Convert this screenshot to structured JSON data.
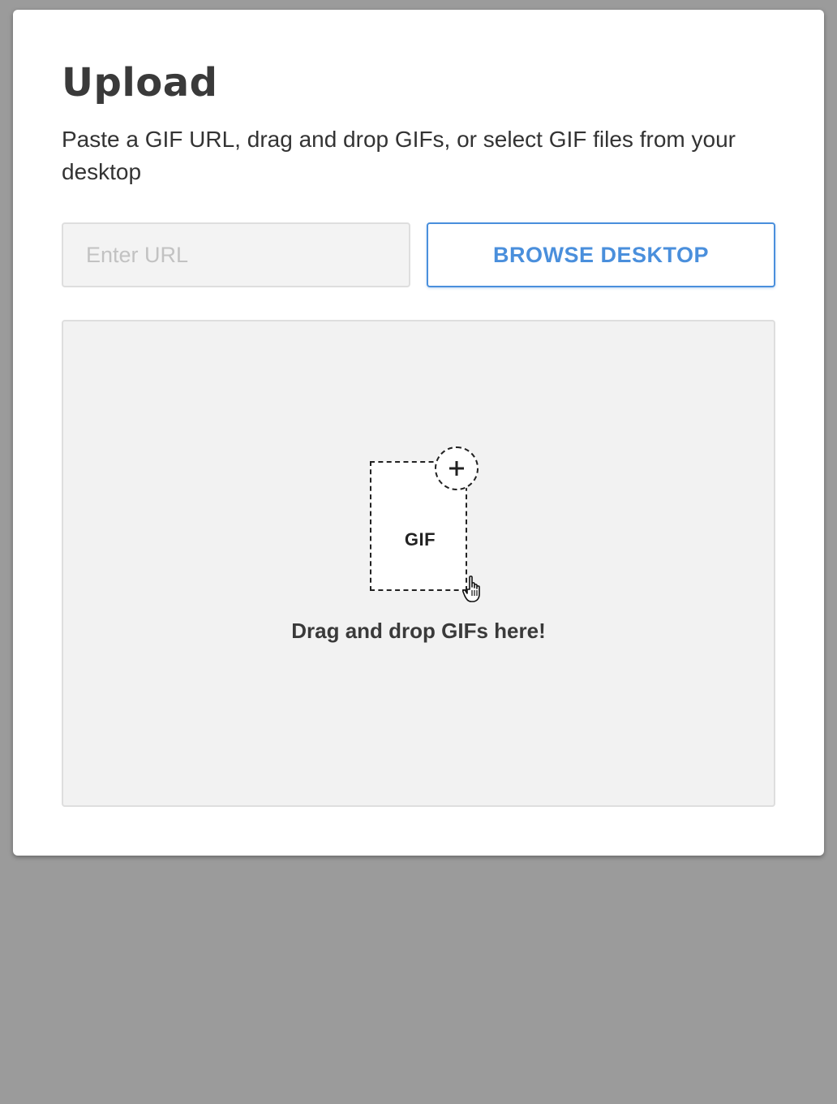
{
  "modal": {
    "title": "Upload",
    "description": "Paste a GIF URL, drag and drop GIFs, or select GIF files from your desktop"
  },
  "url_input": {
    "placeholder": "Enter URL",
    "value": ""
  },
  "browse_button": {
    "label": "BROWSE DESKTOP"
  },
  "dropzone": {
    "file_label": "GIF",
    "instruction": "Drag and drop GIFs here!"
  },
  "icons": {
    "plus": "plus-icon",
    "cursor": "hand-cursor-icon"
  },
  "colors": {
    "accent": "#4a8fdc",
    "overlay": "#9b9b9b",
    "dropzone_bg": "#f2f2f2"
  }
}
